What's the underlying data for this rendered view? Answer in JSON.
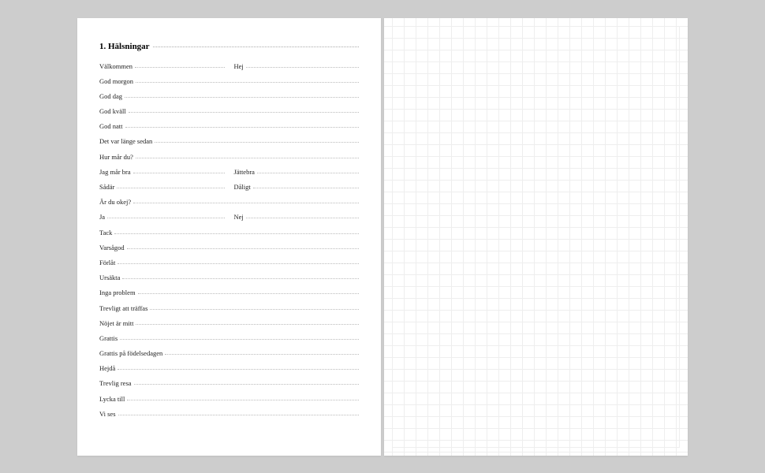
{
  "title": "1. Hälsningar",
  "rows": [
    {
      "type": "pair",
      "a": "Välkommen",
      "b": "Hej"
    },
    {
      "type": "single",
      "a": "God morgon"
    },
    {
      "type": "single",
      "a": "God dag"
    },
    {
      "type": "single",
      "a": "God kväll"
    },
    {
      "type": "single",
      "a": "God natt"
    },
    {
      "type": "single",
      "a": "Det var länge sedan"
    },
    {
      "type": "single",
      "a": "Hur mår du?"
    },
    {
      "type": "pair",
      "a": "Jag mår bra",
      "b": "Jättebra"
    },
    {
      "type": "pair",
      "a": "Sådär",
      "b": "Dåligt"
    },
    {
      "type": "single",
      "a": "Är du okej?"
    },
    {
      "type": "pair",
      "a": "Ja",
      "b": "Nej"
    },
    {
      "type": "single",
      "a": "Tack"
    },
    {
      "type": "single",
      "a": "Varsågod"
    },
    {
      "type": "single",
      "a": "Förlåt"
    },
    {
      "type": "single",
      "a": "Ursäkta"
    },
    {
      "type": "single",
      "a": "Inga problem"
    },
    {
      "type": "single",
      "a": "Trevligt att träffas"
    },
    {
      "type": "single",
      "a": "Nöjet är mitt"
    },
    {
      "type": "single",
      "a": "Grattis"
    },
    {
      "type": "single",
      "a": "Grattis på födelsedagen"
    },
    {
      "type": "single",
      "a": "Hejdå"
    },
    {
      "type": "single",
      "a": "Trevlig resa"
    },
    {
      "type": "single",
      "a": "Lycka till"
    },
    {
      "type": "single",
      "a": "Vi ses"
    }
  ]
}
